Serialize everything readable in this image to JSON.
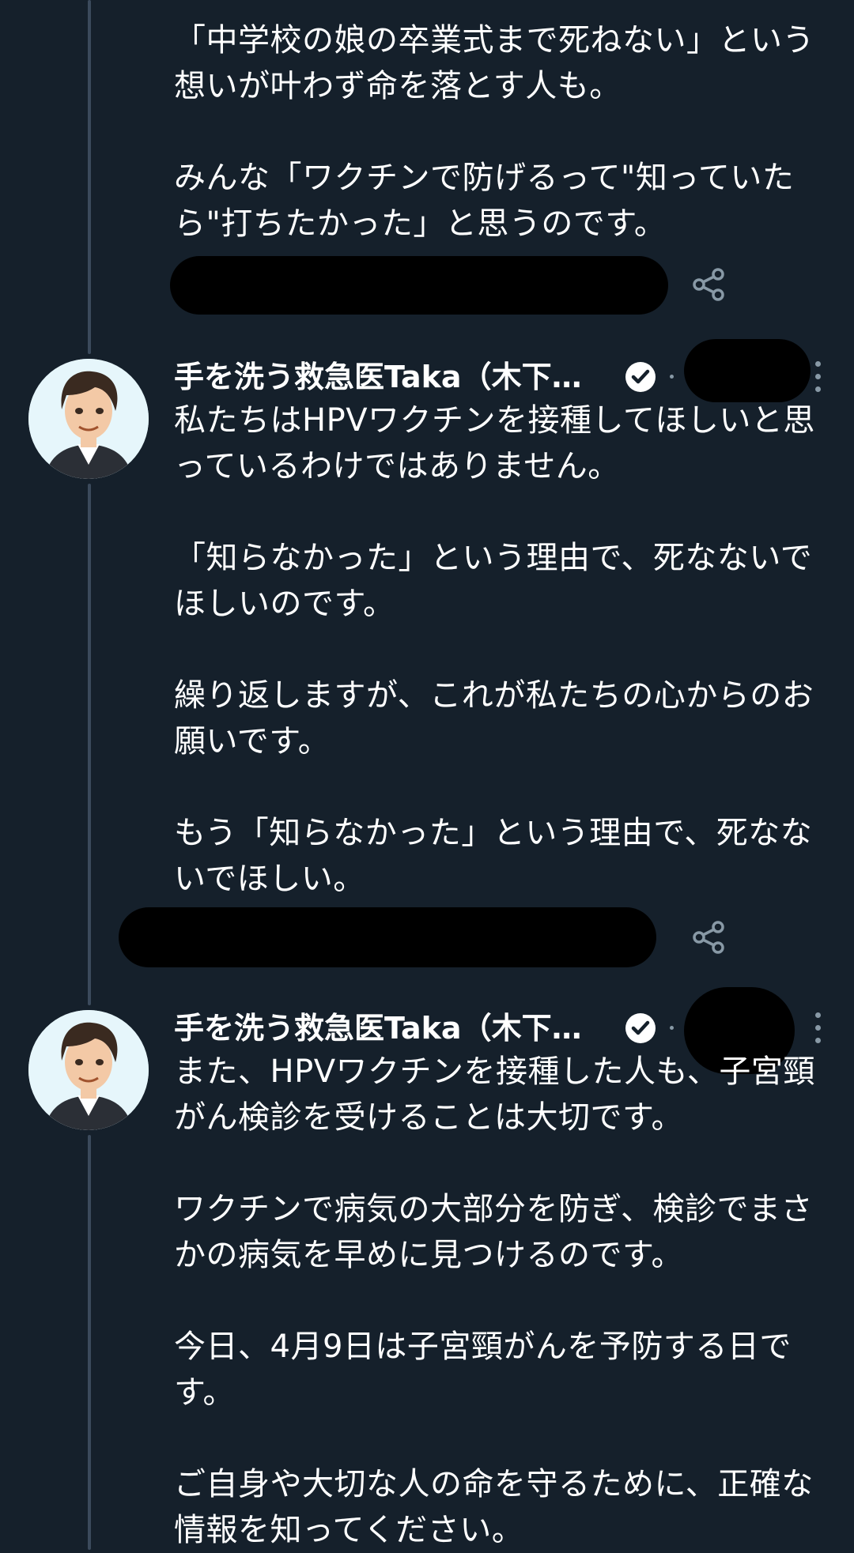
{
  "tweets": [
    {
      "text": "「中学校の娘の卒業式まで死ねない」という想いが叶わず命を落とす人も。\n\nみんな「ワクチンで防げるって\"知っていたら\"打ちたかった」と思うのです。"
    },
    {
      "author": "手を洗う救急医Taka（木下…",
      "text": "私たちはHPVワクチンを接種してほしいと思っているわけではありません。\n\n「知らなかった」という理由で、死なないでほしいのです。\n\n繰り返しますが、これが私たちの心からのお願いです。\n\nもう「知らなかった」という理由で、死なないでほしい。"
    },
    {
      "author": "手を洗う救急医Taka（木下…",
      "text": "また、HPVワクチンを接種した人も、子宮頸がん検診を受けることは大切です。\n\nワクチンで病気の大部分を防ぎ、検診でまさかの病気を早めに見つけるのです。\n\n今日、4月9日は子宮頸がんを予防する日です。\n\nご自身や大切な人の命を守るために、正確な情報を知ってください。"
    }
  ],
  "icons": {
    "share": "share-icon",
    "verified": "verified-badge-icon",
    "more": "more-options-icon"
  },
  "colors": {
    "background": "#15202b",
    "text": "#ffffff",
    "thread_line": "#3b4a5c",
    "secondary": "#8899a6",
    "verified_badge": "#ffffff"
  }
}
